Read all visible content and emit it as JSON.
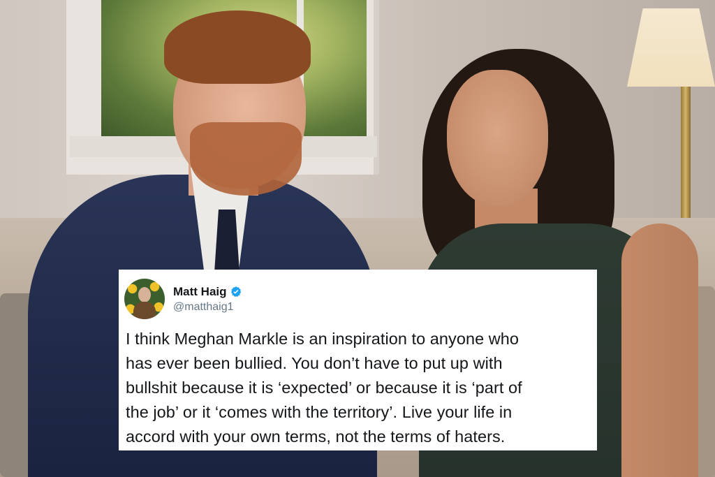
{
  "tweet": {
    "author": {
      "display_name": "Matt Haig",
      "handle": "@matthaig1",
      "verified": true
    },
    "text": "I think Meghan Markle is an inspiration to anyone who\nhas ever been bullied. You don’t have to put up with\nbullshit because it is ‘expected’ or because it is ‘part of\nthe job’ or it ‘comes with the territory’. Live your life in\naccord with your own terms, not the terms of haters."
  },
  "colors": {
    "verified_badge": "#1da1f2",
    "tweet_text": "#14171a",
    "handle_text": "#657786"
  }
}
